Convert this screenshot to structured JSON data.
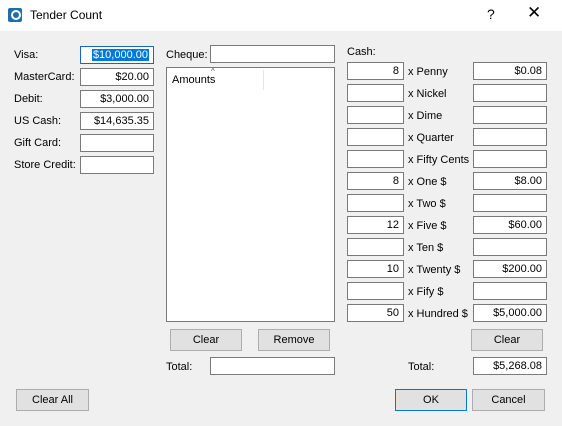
{
  "window": {
    "title": "Tender Count",
    "help": "?",
    "close": "✕"
  },
  "left": {
    "rows": [
      {
        "label": "Visa:",
        "value": "$10,000.00"
      },
      {
        "label": "MasterCard:",
        "value": "$20.00"
      },
      {
        "label": "Debit:",
        "value": "$3,000.00"
      },
      {
        "label": "US Cash:",
        "value": "$14,635.35"
      },
      {
        "label": "Gift Card:",
        "value": ""
      },
      {
        "label": "Store Credit:",
        "value": ""
      }
    ],
    "clear_all": "Clear All"
  },
  "cheque": {
    "label": "Cheque:",
    "input": "",
    "list_header": "Amounts",
    "clear": "Clear",
    "remove": "Remove",
    "total_label": "Total:",
    "total": ""
  },
  "cash": {
    "label": "Cash:",
    "rows": [
      {
        "qty": "8",
        "label": "x Penny",
        "amount": "$0.08"
      },
      {
        "qty": "",
        "label": "x Nickel",
        "amount": ""
      },
      {
        "qty": "",
        "label": "x Dime",
        "amount": ""
      },
      {
        "qty": "",
        "label": "x Quarter",
        "amount": ""
      },
      {
        "qty": "",
        "label": "x Fifty Cents",
        "amount": ""
      },
      {
        "qty": "8",
        "label": "x One $",
        "amount": "$8.00"
      },
      {
        "qty": "",
        "label": "x Two $",
        "amount": ""
      },
      {
        "qty": "12",
        "label": "x Five $",
        "amount": "$60.00"
      },
      {
        "qty": "",
        "label": "x Ten $",
        "amount": ""
      },
      {
        "qty": "10",
        "label": "x Twenty $",
        "amount": "$200.00"
      },
      {
        "qty": "",
        "label": "x Fify $",
        "amount": ""
      },
      {
        "qty": "50",
        "label": "x Hundred $",
        "amount": "$5,000.00"
      }
    ],
    "clear": "Clear",
    "total_label": "Total:",
    "total": "$5,268.08"
  },
  "footer": {
    "ok": "OK",
    "cancel": "Cancel"
  }
}
